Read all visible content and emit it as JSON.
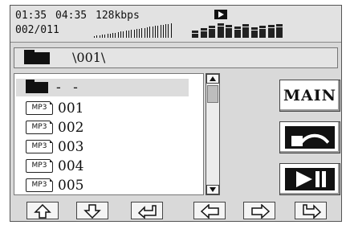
{
  "status": {
    "elapsed_time": "01:35",
    "total_time": "04:35",
    "bitrate": "128kbps",
    "track_position": "002/011",
    "playing_indicator": "play-icon",
    "volume_icon": "volume-ramp-icon",
    "equalizer_icon": "equalizer-bars-icon",
    "equalizer_levels": [
      0.45,
      0.6,
      0.75,
      0.9,
      0.8,
      0.7,
      0.85,
      0.65,
      0.75,
      0.8,
      0.85
    ]
  },
  "path": {
    "folder_icon": "folder-icon",
    "current_path": "\\001\\"
  },
  "file_list": {
    "parent_entry": {
      "icon": "folder-icon",
      "label": "- -"
    },
    "items": [
      {
        "icon_label": "MP3",
        "name": "001"
      },
      {
        "icon_label": "MP3",
        "name": "002"
      },
      {
        "icon_label": "MP3",
        "name": "003"
      },
      {
        "icon_label": "MP3",
        "name": "004"
      },
      {
        "icon_label": "MP3",
        "name": "005"
      }
    ]
  },
  "side_buttons": {
    "main_label": "MAIN",
    "back_icon": "back-arrow-icon",
    "play_pause_icon": "play-pause-icon"
  },
  "nav_buttons": [
    "arrow-up-icon",
    "arrow-down-icon",
    "enter-icon",
    "arrow-left-icon",
    "arrow-right-icon",
    "tab-right-icon"
  ]
}
